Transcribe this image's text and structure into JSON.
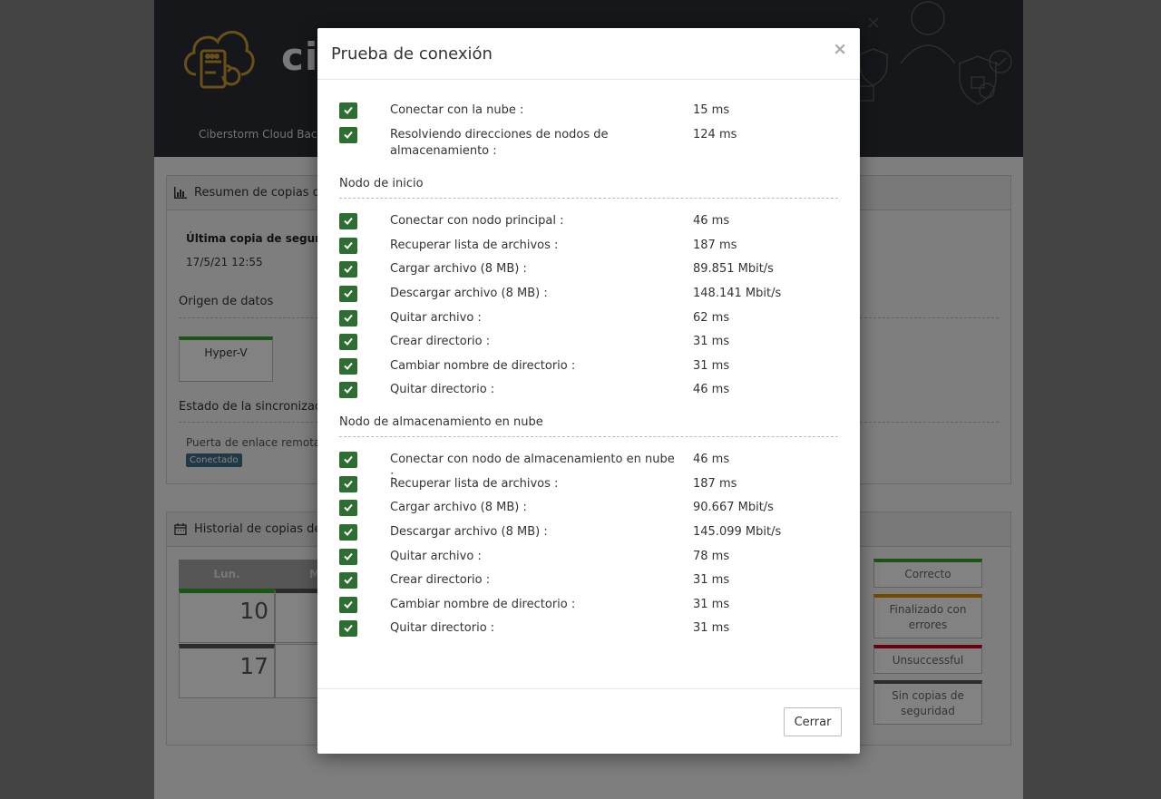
{
  "background": {
    "brand": "ci",
    "subtitle": "Ciberstorm Cloud Backu",
    "summary_panel": {
      "title": "Resumen de copias de",
      "last_backup_label": "Última copia de seguridad",
      "last_backup_time": "17/5/21 12:55",
      "data_source_title": "Origen de datos",
      "data_source_item": "Hyper-V",
      "sync_title": "Estado de la sincronizació",
      "gateway_label": "Puerta de enlace remota",
      "gateway_status": "Conectado"
    },
    "history_panel": {
      "title": "Historial de copias de s",
      "day_headers": [
        "Lun.",
        "M"
      ],
      "days": [
        "10",
        "17"
      ],
      "legend": [
        "Correcto",
        "Finalizado con errores",
        "Unsuccessful",
        "Sin copias de seguridad"
      ]
    }
  },
  "modal": {
    "title": "Prueba de conexión",
    "close_symbol": "×",
    "general_rows": [
      {
        "label": "Conectar con la nube :",
        "value": "15 ms"
      },
      {
        "label": "Resolviendo direcciones de nodos de almacenamiento :",
        "value": "124 ms"
      }
    ],
    "start_node": {
      "title": "Nodo de inicio",
      "rows": [
        {
          "label": "Conectar con nodo principal :",
          "value": "46 ms"
        },
        {
          "label": "Recuperar lista de archivos :",
          "value": "187 ms"
        },
        {
          "label": "Cargar archivo (8 MB) :",
          "value": "89.851 Mbit/s"
        },
        {
          "label": "Descargar archivo (8 MB) :",
          "value": "148.141 Mbit/s"
        },
        {
          "label": "Quitar archivo :",
          "value": "62 ms"
        },
        {
          "label": "Crear directorio :",
          "value": "31 ms"
        },
        {
          "label": "Cambiar nombre de directorio :",
          "value": "31 ms"
        },
        {
          "label": "Quitar directorio :",
          "value": "46 ms"
        }
      ]
    },
    "cloud_node": {
      "title": "Nodo de almacenamiento en nube",
      "rows": [
        {
          "label": "Conectar con nodo de almacenamiento en nube :",
          "value": "46 ms"
        },
        {
          "label": "Recuperar lista de archivos :",
          "value": "187 ms"
        },
        {
          "label": "Cargar archivo (8 MB) :",
          "value": "90.667 Mbit/s"
        },
        {
          "label": "Descargar archivo (8 MB) :",
          "value": "145.099 Mbit/s"
        },
        {
          "label": "Quitar archivo :",
          "value": "78 ms"
        },
        {
          "label": "Crear directorio :",
          "value": "31 ms"
        },
        {
          "label": "Cambiar nombre de directorio :",
          "value": "31 ms"
        },
        {
          "label": "Quitar directorio :",
          "value": "31 ms"
        }
      ]
    },
    "close_button_label": "Cerrar"
  },
  "colors": {
    "check_green": "#2e6e32",
    "success": "#35a32a",
    "warning": "#e08a00",
    "failure": "#d0021b",
    "none": "#555555",
    "header_dark": "#2a2c34"
  }
}
